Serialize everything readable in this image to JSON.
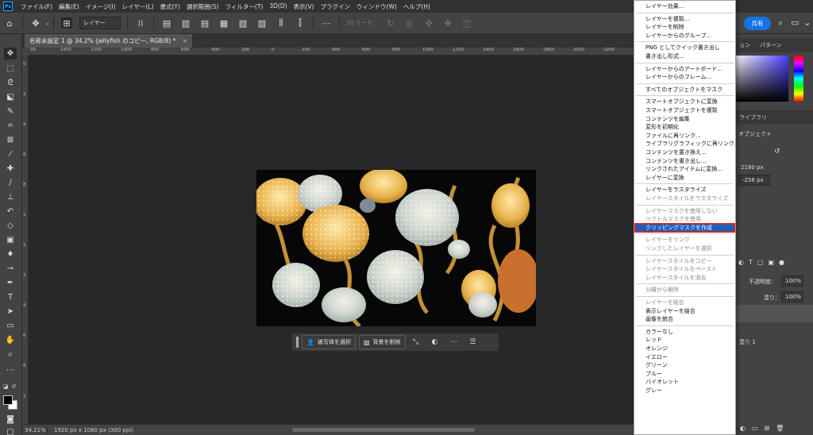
{
  "menubar": {
    "logo": "Ps",
    "items": [
      "ファイル(F)",
      "編集(E)",
      "イメージ(I)",
      "レイヤー(L)",
      "書式(Y)",
      "選択範囲(S)",
      "フィルター(T)",
      "3D(D)",
      "表示(V)",
      "プラグイン",
      "ウィンドウ(W)",
      "ヘルプ(H)"
    ]
  },
  "optionsbar": {
    "target_select": "レイヤー",
    "mode_3d": "3D モード：",
    "share_label": "共有"
  },
  "document": {
    "tab_title": "名称未設定 1 @ 34.2% (jellyfish のコピー, RGB/8) *",
    "ruler_h": [
      "30",
      "1400",
      "1200",
      "1000",
      "800",
      "600",
      "400",
      "200",
      "0",
      "200",
      "400",
      "600",
      "800",
      "1000",
      "1200",
      "1400",
      "1600",
      "1800",
      "2000",
      "2200",
      "2400"
    ],
    "ruler_v": [
      "0",
      "2",
      "4",
      "6",
      "8",
      "1",
      "1",
      "2",
      "4",
      "6",
      "8",
      "1"
    ]
  },
  "taskbar": {
    "select_subject": "被写体を選択",
    "remove_background": "背景を削除"
  },
  "statusbar": {
    "zoom": "34.21%",
    "dimensions": "1920 px x 1080 px (300 ppi)"
  },
  "panels": {
    "top_tabs": [
      "ョン",
      "パターン"
    ],
    "mid_tabs": [
      "ライブラリ"
    ],
    "props_title": "オブジェクト",
    "width_value": "2180 px",
    "y_value": "-256 px",
    "opacity_label": "不透明度：",
    "opacity_value": "100%",
    "fill_label": "塗り：",
    "fill_value": "100%",
    "layer_name": "塗り 1"
  },
  "context_menu": {
    "items": [
      {
        "label": "レイヤー効果...",
        "disabled": false
      },
      {
        "sep": true
      },
      {
        "label": "レイヤーを複製...",
        "disabled": false
      },
      {
        "label": "レイヤーを削除",
        "disabled": false
      },
      {
        "label": "レイヤーからのグループ...",
        "disabled": false
      },
      {
        "sep": true
      },
      {
        "label": "PNG としてクイック書き出し",
        "disabled": false
      },
      {
        "label": "書き出し形式...",
        "disabled": false
      },
      {
        "sep": true
      },
      {
        "label": "レイヤーからのアートボード...",
        "disabled": false
      },
      {
        "label": "レイヤーからのフレーム...",
        "disabled": false
      },
      {
        "sep": true
      },
      {
        "label": "すべてのオブジェクトをマスク",
        "disabled": false
      },
      {
        "sep": true
      },
      {
        "label": "スマートオブジェクトに変換",
        "disabled": false
      },
      {
        "label": "スマートオブジェクトを複製",
        "disabled": false
      },
      {
        "label": "コンテンツを編集",
        "disabled": false
      },
      {
        "label": "変形を初期化",
        "disabled": false
      },
      {
        "label": "ファイルに再リンク...",
        "disabled": false
      },
      {
        "label": "ライブラリグラフィックに再リンク...",
        "disabled": false
      },
      {
        "label": "コンテンツを置き換え...",
        "disabled": false
      },
      {
        "label": "コンテンツを書き出し...",
        "disabled": false
      },
      {
        "label": "リンクされたアイテムに変換...",
        "disabled": false
      },
      {
        "label": "レイヤーに変換",
        "disabled": false
      },
      {
        "sep": true
      },
      {
        "label": "レイヤーをラスタライズ",
        "disabled": false
      },
      {
        "label": "レイヤースタイルをラスタライズ",
        "disabled": true
      },
      {
        "sep": true
      },
      {
        "label": "レイヤーマスクを使用しない",
        "disabled": true
      },
      {
        "label": "ベクトルマスクを使用",
        "disabled": true
      },
      {
        "label": "クリッピングマスクを作成",
        "disabled": false,
        "highlight": true
      },
      {
        "sep": true
      },
      {
        "label": "レイヤーをリンク",
        "disabled": true
      },
      {
        "label": "リンクしたレイヤーを選択",
        "disabled": true
      },
      {
        "sep": true
      },
      {
        "label": "レイヤースタイルをコピー",
        "disabled": true
      },
      {
        "label": "レイヤースタイルをペースト",
        "disabled": true
      },
      {
        "label": "レイヤースタイルを消去",
        "disabled": true
      },
      {
        "sep": true
      },
      {
        "label": "分離から解除",
        "disabled": true
      },
      {
        "sep": true
      },
      {
        "label": "レイヤーを結合",
        "disabled": true
      },
      {
        "label": "表示レイヤーを結合",
        "disabled": false
      },
      {
        "label": "画像を統合",
        "disabled": false
      },
      {
        "sep": true
      },
      {
        "label": "カラーなし",
        "disabled": false
      },
      {
        "label": "レッド",
        "disabled": false
      },
      {
        "label": "オレンジ",
        "disabled": false
      },
      {
        "label": "イエロー",
        "disabled": false
      },
      {
        "label": "グリーン",
        "disabled": false
      },
      {
        "label": "ブルー",
        "disabled": false
      },
      {
        "label": "バイオレット",
        "disabled": false
      },
      {
        "label": "グレー",
        "disabled": false
      }
    ]
  },
  "colors": {
    "accent": "#1473e6",
    "highlight": "#0a64c8",
    "highlight_border": "#e02020"
  }
}
